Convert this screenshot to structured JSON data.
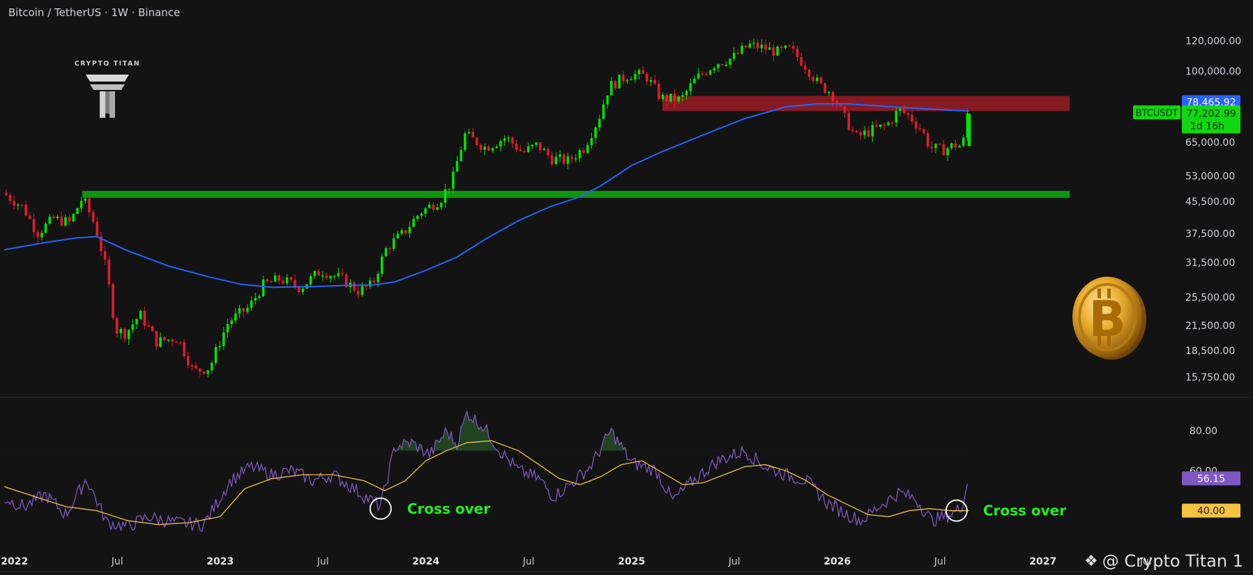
{
  "header": {
    "title": "Bitcoin / TetherUS · 1W · Binance"
  },
  "logo": {
    "brand": "CRYPTO TITAN",
    "icon": "crypto-titan-logo"
  },
  "watermark": {
    "text": "@ Crypto Titan 1",
    "icon": "tradingview-diamond-icon"
  },
  "colors": {
    "background": "#131313",
    "up": "#00e600",
    "down": "#e8192c",
    "ma": "#2962ff",
    "support": "#0f9d0f",
    "resistance": "#8b1a24",
    "rsi": "#7e57c2",
    "rsi_ma": "#f5c242",
    "cross_label": "#22ee22"
  },
  "price_tags": {
    "symbol": "BTCUSDT",
    "ma_value": "78,465.92",
    "price": "77,202.99",
    "countdown": "1d 16h",
    "rsi_value": "56.15",
    "rsi_ma_value": "40.00"
  },
  "annotations": [
    {
      "text": "Cross over",
      "x": 2023.78,
      "rsi": 41
    },
    {
      "text": "Cross over",
      "x": 2026.58,
      "rsi": 40
    }
  ],
  "chart_data": {
    "type": "line",
    "title": "Bitcoin / TetherUS · 1W · Binance",
    "price_scale": "log",
    "price_ylim": [
      14800,
      133000
    ],
    "price_ticks": [
      "120,000.00",
      "100,000.00",
      "65,000.00",
      "53,000.00",
      "45,500.00",
      "37,500.00",
      "31,500.00",
      "25,500.00",
      "21,500.00",
      "18,500.00",
      "15,750.00"
    ],
    "rsi_ylim": [
      20,
      95
    ],
    "rsi_ticks": [
      "80.00",
      "60.00"
    ],
    "xlim": [
      2021.95,
      2027.15
    ],
    "x_ticks": [
      {
        "label": "2022",
        "x": 2022.0
      },
      {
        "label": "Jul",
        "x": 2022.5
      },
      {
        "label": "2023",
        "x": 2023.0
      },
      {
        "label": "Jul",
        "x": 2023.5
      },
      {
        "label": "2024",
        "x": 2024.0
      },
      {
        "label": "Jul",
        "x": 2024.5
      },
      {
        "label": "2025",
        "x": 2025.0
      },
      {
        "label": "Jul",
        "x": 2025.5
      },
      {
        "label": "2026",
        "x": 2026.0
      },
      {
        "label": "Jul",
        "x": 2026.5
      },
      {
        "label": "2027",
        "x": 2027.0
      },
      {
        "label": "Jul",
        "x": 2027.5
      }
    ],
    "zones": [
      {
        "name": "support",
        "x0": 2022.33,
        "x1": 2027.13,
        "y0": 46500,
        "y1": 48500
      },
      {
        "name": "resistance",
        "x0": 2025.15,
        "x1": 2027.13,
        "y0": 78500,
        "y1": 86000
      }
    ],
    "price_path": [
      [
        2021.95,
        48000
      ],
      [
        2022.05,
        44000
      ],
      [
        2022.12,
        37500
      ],
      [
        2022.2,
        41000
      ],
      [
        2022.28,
        40000
      ],
      [
        2022.34,
        46500
      ],
      [
        2022.4,
        39500
      ],
      [
        2022.45,
        31000
      ],
      [
        2022.5,
        21000
      ],
      [
        2022.55,
        20500
      ],
      [
        2022.62,
        23000
      ],
      [
        2022.7,
        19500
      ],
      [
        2022.8,
        20000
      ],
      [
        2022.88,
        16300
      ],
      [
        2022.96,
        16700
      ],
      [
        2023.05,
        22000
      ],
      [
        2023.15,
        24000
      ],
      [
        2023.22,
        27500
      ],
      [
        2023.3,
        28500
      ],
      [
        2023.4,
        27000
      ],
      [
        2023.5,
        30000
      ],
      [
        2023.6,
        28500
      ],
      [
        2023.68,
        26500
      ],
      [
        2023.75,
        27500
      ],
      [
        2023.82,
        34500
      ],
      [
        2023.9,
        37500
      ],
      [
        2023.98,
        42500
      ],
      [
        2024.08,
        46000
      ],
      [
        2024.14,
        52000
      ],
      [
        2024.2,
        68000
      ],
      [
        2024.3,
        63000
      ],
      [
        2024.4,
        67000
      ],
      [
        2024.48,
        61000
      ],
      [
        2024.55,
        64000
      ],
      [
        2024.62,
        59000
      ],
      [
        2024.7,
        58000
      ],
      [
        2024.78,
        63000
      ],
      [
        2024.85,
        75000
      ],
      [
        2024.9,
        91000
      ],
      [
        2025.0,
        98000
      ],
      [
        2025.08,
        97000
      ],
      [
        2025.15,
        85000
      ],
      [
        2025.25,
        84000
      ],
      [
        2025.32,
        95000
      ],
      [
        2025.42,
        105000
      ],
      [
        2025.5,
        108000
      ],
      [
        2025.58,
        117000
      ],
      [
        2025.65,
        115000
      ],
      [
        2025.72,
        112000
      ],
      [
        2025.78,
        114000
      ],
      [
        2025.85,
        104000
      ],
      [
        2025.92,
        92000
      ],
      [
        2025.98,
        88000
      ],
      [
        2026.04,
        76000
      ],
      [
        2026.1,
        67000
      ],
      [
        2026.18,
        70000
      ],
      [
        2026.25,
        72000
      ],
      [
        2026.31,
        79000
      ],
      [
        2026.36,
        76000
      ],
      [
        2026.42,
        70000
      ],
      [
        2026.46,
        63000
      ],
      [
        2026.52,
        62000
      ],
      [
        2026.58,
        64000
      ],
      [
        2026.62,
        63500
      ],
      [
        2026.64,
        77200
      ]
    ],
    "ma_path": [
      [
        2021.95,
        34000
      ],
      [
        2022.15,
        35500
      ],
      [
        2022.3,
        36500
      ],
      [
        2022.4,
        36800
      ],
      [
        2022.55,
        33800
      ],
      [
        2022.75,
        30800
      ],
      [
        2022.95,
        28800
      ],
      [
        2023.1,
        27600
      ],
      [
        2023.25,
        27100
      ],
      [
        2023.45,
        27200
      ],
      [
        2023.6,
        27400
      ],
      [
        2023.75,
        27500
      ],
      [
        2023.85,
        28000
      ],
      [
        2024.0,
        30000
      ],
      [
        2024.15,
        32500
      ],
      [
        2024.3,
        36500
      ],
      [
        2024.45,
        40500
      ],
      [
        2024.6,
        44000
      ],
      [
        2024.75,
        46800
      ],
      [
        2024.85,
        50000
      ],
      [
        2025.0,
        56500
      ],
      [
        2025.15,
        61500
      ],
      [
        2025.35,
        68000
      ],
      [
        2025.55,
        75000
      ],
      [
        2025.75,
        80500
      ],
      [
        2025.9,
        82000
      ],
      [
        2026.05,
        82000
      ],
      [
        2026.2,
        81000
      ],
      [
        2026.35,
        80000
      ],
      [
        2026.5,
        79200
      ],
      [
        2026.64,
        78466
      ]
    ],
    "rsi_path": [
      [
        2021.95,
        46
      ],
      [
        2022.05,
        42
      ],
      [
        2022.15,
        48
      ],
      [
        2022.25,
        38
      ],
      [
        2022.35,
        56
      ],
      [
        2022.45,
        34
      ],
      [
        2022.55,
        32
      ],
      [
        2022.65,
        37
      ],
      [
        2022.78,
        34
      ],
      [
        2022.92,
        33
      ],
      [
        2023.05,
        55
      ],
      [
        2023.15,
        62
      ],
      [
        2023.25,
        58
      ],
      [
        2023.35,
        60
      ],
      [
        2023.45,
        55
      ],
      [
        2023.55,
        58
      ],
      [
        2023.65,
        51
      ],
      [
        2023.72,
        46
      ],
      [
        2023.78,
        42
      ],
      [
        2023.85,
        72
      ],
      [
        2023.93,
        74
      ],
      [
        2024.02,
        68
      ],
      [
        2024.1,
        80
      ],
      [
        2024.15,
        73
      ],
      [
        2024.2,
        89
      ],
      [
        2024.28,
        82
      ],
      [
        2024.36,
        70
      ],
      [
        2024.45,
        60
      ],
      [
        2024.55,
        56
      ],
      [
        2024.62,
        47
      ],
      [
        2024.7,
        53
      ],
      [
        2024.8,
        62
      ],
      [
        2024.9,
        80
      ],
      [
        2025.0,
        64
      ],
      [
        2025.12,
        60
      ],
      [
        2025.2,
        45
      ],
      [
        2025.3,
        55
      ],
      [
        2025.42,
        65
      ],
      [
        2025.55,
        70
      ],
      [
        2025.65,
        62
      ],
      [
        2025.75,
        58
      ],
      [
        2025.85,
        55
      ],
      [
        2025.95,
        44
      ],
      [
        2026.05,
        38
      ],
      [
        2026.12,
        35
      ],
      [
        2026.2,
        42
      ],
      [
        2026.3,
        49
      ],
      [
        2026.38,
        46
      ],
      [
        2026.46,
        35
      ],
      [
        2026.55,
        38
      ],
      [
        2026.6,
        41
      ],
      [
        2026.64,
        56
      ]
    ],
    "rsi_ma_path": [
      [
        2021.95,
        52
      ],
      [
        2022.1,
        47
      ],
      [
        2022.25,
        42
      ],
      [
        2022.4,
        40
      ],
      [
        2022.55,
        35
      ],
      [
        2022.7,
        33
      ],
      [
        2022.85,
        34
      ],
      [
        2023.0,
        37
      ],
      [
        2023.12,
        51
      ],
      [
        2023.25,
        56
      ],
      [
        2023.4,
        58
      ],
      [
        2023.55,
        58
      ],
      [
        2023.7,
        55
      ],
      [
        2023.8,
        50
      ],
      [
        2023.9,
        55
      ],
      [
        2024.0,
        65
      ],
      [
        2024.1,
        70
      ],
      [
        2024.2,
        74
      ],
      [
        2024.32,
        75
      ],
      [
        2024.45,
        70
      ],
      [
        2024.55,
        63
      ],
      [
        2024.65,
        56
      ],
      [
        2024.75,
        53
      ],
      [
        2024.85,
        57
      ],
      [
        2024.95,
        63
      ],
      [
        2025.05,
        65
      ],
      [
        2025.15,
        59
      ],
      [
        2025.25,
        53
      ],
      [
        2025.35,
        54
      ],
      [
        2025.45,
        58
      ],
      [
        2025.55,
        62
      ],
      [
        2025.65,
        63
      ],
      [
        2025.75,
        60
      ],
      [
        2025.85,
        55
      ],
      [
        2025.95,
        48
      ],
      [
        2026.05,
        43
      ],
      [
        2026.15,
        38
      ],
      [
        2026.25,
        37
      ],
      [
        2026.35,
        40
      ],
      [
        2026.45,
        41
      ],
      [
        2026.55,
        40
      ],
      [
        2026.64,
        40
      ]
    ]
  }
}
